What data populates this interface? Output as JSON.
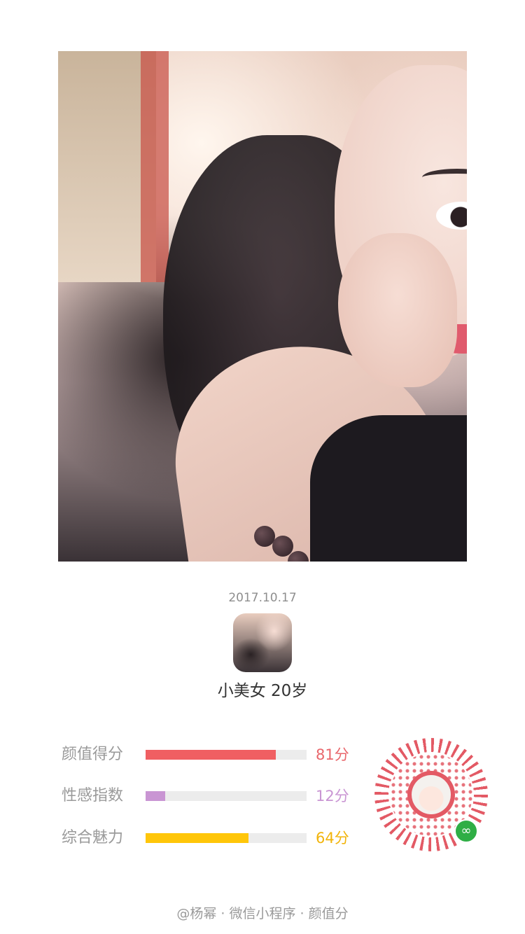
{
  "photo": {
    "alt": "selfie photo"
  },
  "date": "2017.10.17",
  "profile": {
    "name": "小美女 20岁"
  },
  "stats": [
    {
      "label": "颜值得分",
      "score": "81分",
      "value": 81,
      "color": "#f05f62",
      "scoreColor": "#e9676c"
    },
    {
      "label": "性感指数",
      "score": "12分",
      "value": 12,
      "color": "#c995d3",
      "scoreColor": "#c995d3"
    },
    {
      "label": "综合魅力",
      "score": "64分",
      "value": 64,
      "color": "#ffc60a",
      "scoreColor": "#f2b40a"
    }
  ],
  "qr": {
    "icon": "mini-program-qr-code",
    "badge_icon": "wechat-mini-program-icon"
  },
  "footer": "@杨幂 · 微信小程序 · 颜值分"
}
